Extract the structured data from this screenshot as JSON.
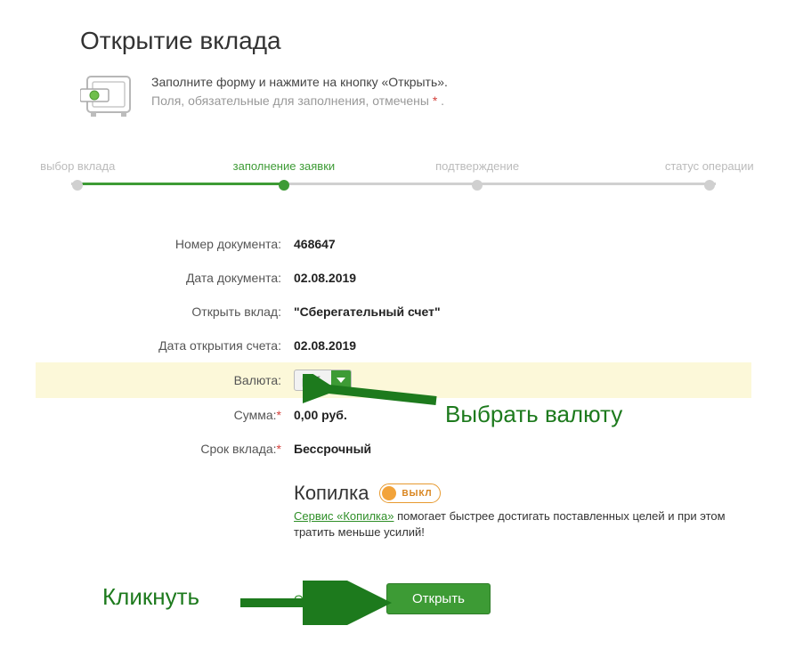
{
  "page": {
    "title": "Открытие вклада",
    "intro_line1": "Заполните форму и нажмите на кнопку «Открыть».",
    "intro_line2_pre": "Поля, обязательные для заполнения, отмечены ",
    "intro_line2_post": " ."
  },
  "steps": {
    "s1": "выбор вклада",
    "s2": "заполнение заявки",
    "s3": "подтверждение",
    "s4": "статус операции",
    "active_index": 1
  },
  "form": {
    "doc_number_label": "Номер документа:",
    "doc_number": "468647",
    "doc_date_label": "Дата документа:",
    "doc_date": "02.08.2019",
    "open_deposit_label": "Открыть вклад:",
    "open_deposit": "\"Сберегательный счет\"",
    "account_open_date_label": "Дата открытия счета:",
    "account_open_date": "02.08.2019",
    "currency_label": "Валюта:",
    "currency_value": "руб.",
    "amount_label": "Сумма:",
    "amount_value": "0,00 руб.",
    "term_label": "Срок вклада:",
    "term_value": "Бессрочный"
  },
  "kopilka": {
    "title": "Копилка",
    "toggle_label": "ВЫКЛ",
    "link_text": "Сервис «Копилка»",
    "desc_rest": " помогает быстрее достигать поставленных целей и при этом тратить меньше усилий!"
  },
  "actions": {
    "cancel": "Отменить",
    "open": "Открыть"
  },
  "annotations": {
    "select_currency": "Выбрать валюту",
    "click": "Кликнуть"
  },
  "colors": {
    "accent": "#3d9b35",
    "highlight_bg": "#fcf8d9",
    "orange": "#e79a2f"
  }
}
